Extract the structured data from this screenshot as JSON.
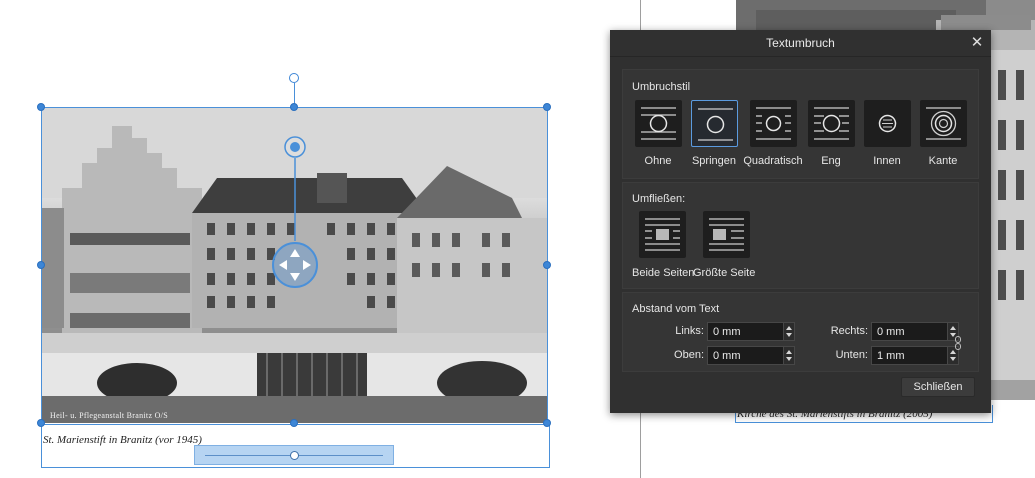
{
  "canvas": {
    "photo_inscription": "Heil- u. Pflegeanstalt Branitz O/S",
    "caption_left": "St. Marienstift in Branitz (vor 1945)",
    "caption_right": "Kirche des St. Marienstifts in Branitz (2005)"
  },
  "dialog": {
    "title": "Textumbruch",
    "close_glyph": "✕",
    "wrap_style_section": {
      "label": "Umbruchstil",
      "options": [
        "Ohne",
        "Springen",
        "Quadratisch",
        "Eng",
        "Innen",
        "Kante"
      ],
      "selected": "Springen"
    },
    "flow_section": {
      "label": "Umfließen:",
      "options": [
        "Beide Seiten",
        "Größte Seite"
      ]
    },
    "distance_section": {
      "label": "Abstand vom Text",
      "left_label": "Links:",
      "left_value": "0 mm",
      "right_label": "Rechts:",
      "right_value": "0 mm",
      "top_label": "Oben:",
      "top_value": "0 mm",
      "bottom_label": "Unten:",
      "bottom_value": "1 mm"
    },
    "close_button": "Schließen"
  },
  "icons": {
    "close": "close-icon",
    "move": "move-handle-icon",
    "link": "chain-link-icon"
  },
  "colors": {
    "selection": "#4a90d9",
    "dialog_bg": "#303030",
    "selected_option_border": "#5b9be0"
  }
}
